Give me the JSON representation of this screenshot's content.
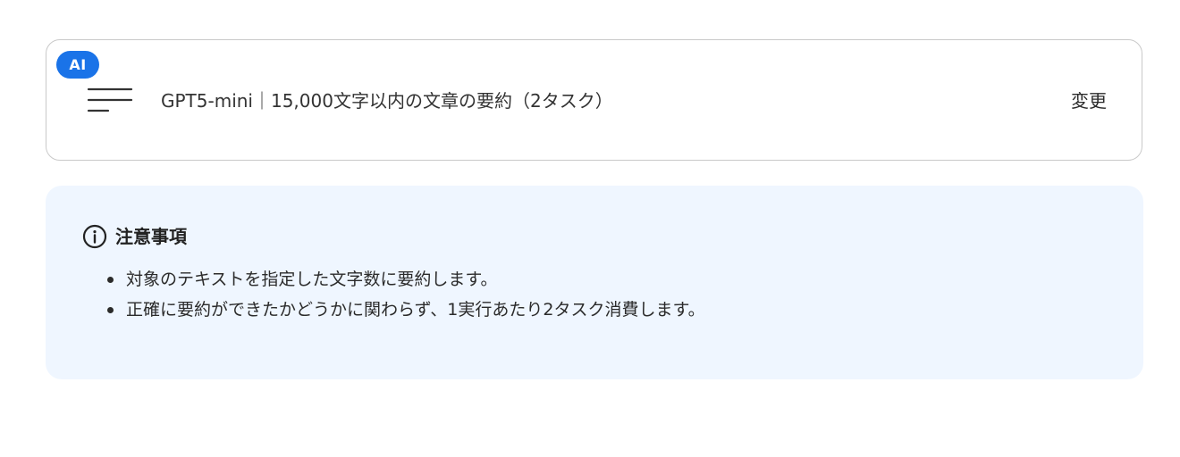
{
  "action": {
    "badge": "AI",
    "icon": "summary-lines-icon",
    "title": "GPT5-mini｜15,000文字以内の文章の要約（2タスク）",
    "change_label": "変更"
  },
  "notice": {
    "icon": "info-circle-icon",
    "title": "注意事項",
    "items": [
      "対象のテキストを指定した文字数に要約します。",
      "正確に要約ができたかどうかに関わらず、1実行あたり2タスク消費します。"
    ]
  },
  "colors": {
    "badge_bg": "#1a73e8",
    "notice_bg": "#eff6ff",
    "card_border": "#c9c9c9"
  }
}
